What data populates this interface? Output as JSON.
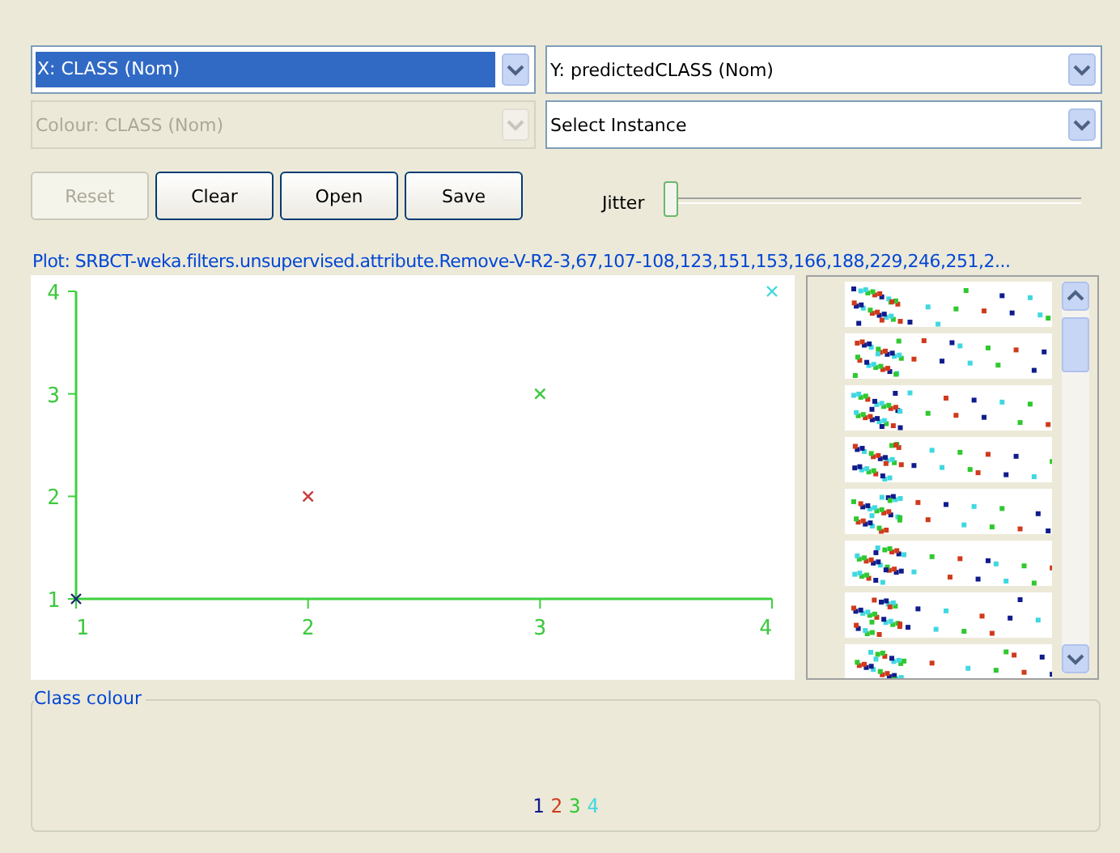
{
  "combos": [
    {
      "value": "X: CLASS (Nom)",
      "focused": true,
      "disabled": false
    },
    {
      "value": "Y: predictedCLASS (Nom)",
      "focused": false,
      "disabled": false
    },
    {
      "value": "Colour: CLASS (Nom)",
      "focused": false,
      "disabled": true
    },
    {
      "value": "Select Instance",
      "focused": false,
      "disabled": false
    }
  ],
  "buttons": [
    {
      "label": "Reset",
      "disabled": true
    },
    {
      "label": "Clear",
      "disabled": false
    },
    {
      "label": "Open",
      "disabled": false
    },
    {
      "label": "Save",
      "disabled": false
    }
  ],
  "jitter": {
    "label": "Jitter",
    "level": 0
  },
  "plot": {
    "title": "Plot: SRBCT-weka.filters.unsupervised.attribute.Remove-V-R2-3,67,107-108,123,151,153,166,188,229,246,251,2...",
    "chart_data": {
      "type": "scatter",
      "x": [
        1,
        2,
        3,
        4
      ],
      "xlim": [
        1,
        4
      ],
      "ylim": [
        1,
        4
      ],
      "xticks": [
        1,
        2,
        3,
        4
      ],
      "yticks": [
        1,
        2,
        3,
        4
      ],
      "series": [
        {
          "color": "#1a2a6c",
          "values": [
            1,
            null,
            null,
            null
          ]
        },
        {
          "color": "#c83c3c",
          "values": [
            null,
            2,
            null,
            null
          ]
        },
        {
          "color": "#3cc83c",
          "values": [
            null,
            null,
            3,
            null
          ]
        },
        {
          "color": "#40d8e0",
          "values": [
            null,
            null,
            null,
            4
          ]
        }
      ]
    }
  },
  "class_colour": {
    "title": "Class colour",
    "classes": [
      {
        "label": "1",
        "color": "#101c8c"
      },
      {
        "label": "2",
        "color": "#d03a1c"
      },
      {
        "label": "3",
        "color": "#30c830"
      },
      {
        "label": "4",
        "color": "#40d8e0"
      }
    ]
  }
}
